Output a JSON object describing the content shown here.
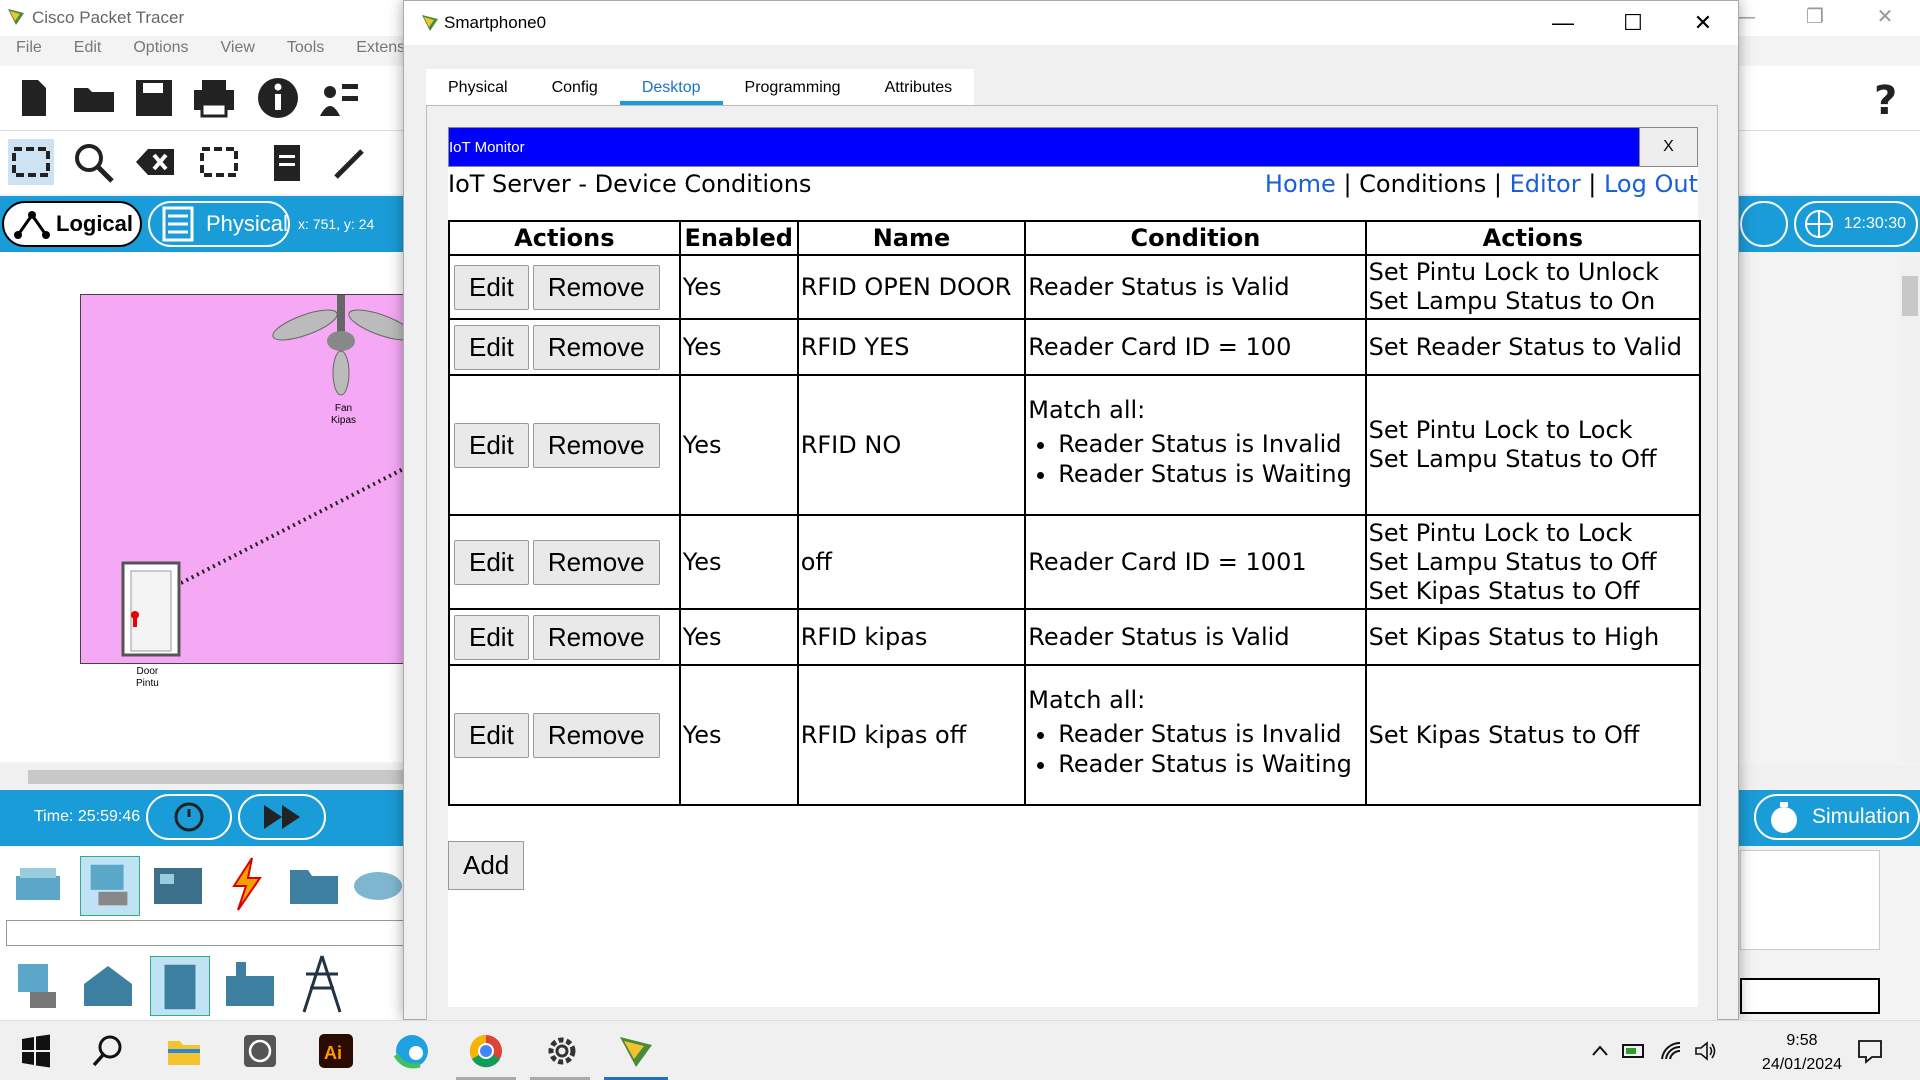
{
  "app": {
    "title": "Cisco Packet Tracer",
    "menu": [
      "File",
      "Edit",
      "Options",
      "View",
      "Tools",
      "Extens"
    ],
    "view_tabs": {
      "logical": "Logical",
      "physical": "Physical"
    },
    "coords": "x: 751, y: 24",
    "time": "Time: 25:59:46",
    "clock_badge": "12:30:30",
    "simulation_label": "Simulation",
    "devices": [
      {
        "name": "Fan",
        "label": "Kipas"
      },
      {
        "name": "Door",
        "label": "Pintu"
      }
    ]
  },
  "dialog": {
    "title": "Smartphone0",
    "tabs": [
      "Physical",
      "Config",
      "Desktop",
      "Programming",
      "Attributes"
    ],
    "active_tab": "Desktop"
  },
  "iot": {
    "header": "IoT Monitor",
    "close": "X",
    "page_title": "IoT Server - Device Conditions",
    "nav": {
      "home": "Home",
      "sep": "|",
      "conditions": "Conditions",
      "editor": "Editor",
      "logout": "Log Out"
    },
    "columns": [
      "Actions",
      "Enabled",
      "Name",
      "Condition",
      "Actions"
    ],
    "edit_label": "Edit",
    "remove_label": "Remove",
    "add_label": "Add",
    "rows": [
      {
        "enabled": "Yes",
        "name": "RFID OPEN DOOR",
        "condition_head": "Reader Status is Valid",
        "condition_items": [],
        "actions": [
          "Set Pintu Lock to Unlock",
          "Set Lampu Status to On"
        ]
      },
      {
        "enabled": "Yes",
        "name": "RFID YES",
        "condition_head": "Reader Card ID = 100",
        "condition_items": [],
        "actions": [
          "Set Reader Status to Valid"
        ]
      },
      {
        "enabled": "Yes",
        "name": "RFID NO",
        "condition_head": "Match all:",
        "condition_items": [
          "Reader Status is Invalid",
          "Reader Status is Waiting"
        ],
        "actions": [
          "Set Pintu Lock to Lock",
          "Set Lampu Status to Off"
        ]
      },
      {
        "enabled": "Yes",
        "name": "off",
        "condition_head": "Reader Card ID = 1001",
        "condition_items": [],
        "actions": [
          "Set Pintu Lock to Lock",
          "Set Lampu Status to Off",
          "Set Kipas Status to Off"
        ]
      },
      {
        "enabled": "Yes",
        "name": "RFID kipas",
        "condition_head": "Reader Status is Valid",
        "condition_items": [],
        "actions": [
          "Set Kipas Status to High"
        ]
      },
      {
        "enabled": "Yes",
        "name": "RFID kipas off",
        "condition_head": "Match all:",
        "condition_items": [
          "Reader Status is Invalid",
          "Reader Status is Waiting"
        ],
        "actions": [
          "Set Kipas Status to Off"
        ]
      }
    ]
  },
  "taskbar": {
    "time": "9:58",
    "date": "24/01/2024"
  },
  "colors": {
    "pt_blue": "#1a9cd8",
    "iot_header": "#0000ff",
    "link": "#1a5fd6",
    "room": "#f5a9f5"
  }
}
